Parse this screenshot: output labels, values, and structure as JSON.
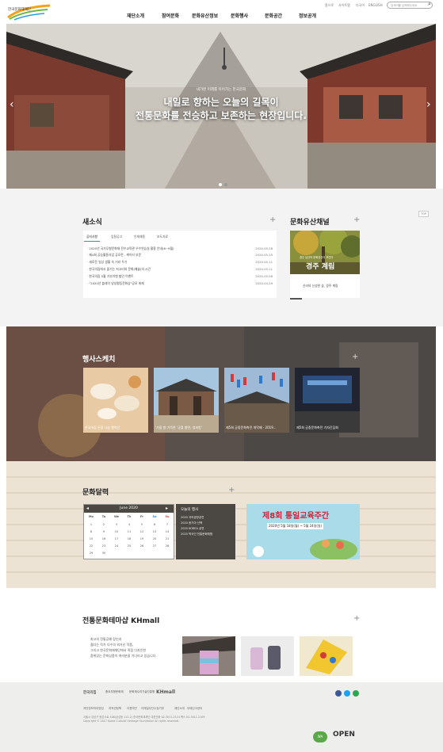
{
  "header": {
    "logo_text": "한국문화재재단",
    "util_links": [
      "홈으로",
      "사이트맵",
      "다국어",
      "ENGLISH"
    ],
    "search_placeholder": "검색어를 입력해주세요",
    "gnb": [
      "재단소개",
      "참여문화",
      "문화유산정보",
      "문화행사",
      "문화공간",
      "정보공개"
    ]
  },
  "hero": {
    "subtitle": "내가본 미래를 이어가는 한국문화",
    "title_line1": "내일로 향하는 오늘의 길목이",
    "title_line2": "전통문화를 전승하고 보존하는 현장입니다.",
    "prev": "‹",
    "next": "›"
  },
  "news": {
    "title": "새소식",
    "tabs": [
      "공지사항",
      "입찰공고",
      "인재채용",
      "보도자료"
    ],
    "items": [
      {
        "text": "2020년 국가무형문화재 전수교육관 우수연습실 활용 안내(6~9월)",
        "date": "2020.05.28"
      },
      {
        "text": "제4회 공능활용사업 공모전 - 케이티 부문",
        "date": "2020.05.25"
      },
      {
        "text": "세로운 일상 생활 속 거리 두기",
        "date": "2020.05.11"
      },
      {
        "text": "한국의집에서 즐기는 저고리와 문화(예술)의 시간",
        "date": "2020.05.11"
      },
      {
        "text": "한국의집 5월 기부이벤 할인 이벤트",
        "date": "2020.05.06"
      },
      {
        "text": "\"2020년 블레이 양성평등문화상\"공모 게재",
        "date": "2020.04.29"
      }
    ]
  },
  "channel": {
    "title": "문화유산채널",
    "img_small": "경주 남산의 문화유산이 보인다",
    "img_big": "경주 계림",
    "caption": "신라의 신성한 숲, 경주 계림",
    "side": "TOP"
  },
  "events": {
    "title": "행사스케치",
    "cards": [
      "한국의집 온정 나눔 행복단",
      "'가을 향 가득한 '궁궐 향연, 생과방'",
      "제5회 궁중문화축전 개막제 - 2019...",
      "제5회 궁중문화축전 기자간담회"
    ]
  },
  "calendar": {
    "title": "문화달력",
    "month": "June 2020",
    "weekdays": [
      "Mo",
      "Tu",
      "We",
      "Th",
      "Fr",
      "Sa",
      "Su"
    ],
    "weeks": [
      [
        "1",
        "2",
        "3",
        "4",
        "5",
        "6",
        "7"
      ],
      [
        "8",
        "9",
        "10",
        "11",
        "12",
        "13",
        "14"
      ],
      [
        "15",
        "16",
        "17",
        "18",
        "19",
        "20",
        "21"
      ],
      [
        "22",
        "23",
        "24",
        "25",
        "26",
        "27",
        "28"
      ],
      [
        "29",
        "30",
        "",
        "",
        "",
        "",
        ""
      ]
    ],
    "schedule_title": "오늘의 행사",
    "schedule": [
      "2020 국악공방공연",
      "2020 동기아 산책",
      "2020 KOREA 공연",
      "2020 박국인 전통문화체험"
    ],
    "banner_title": "제8회 통일교육주간",
    "banner_date": "2020년 5월 18일(월) ~ 5월 24일(일)"
  },
  "khmall": {
    "title": "전통문화테마샵 KHmall",
    "desc": [
      "최고의 전통공예 장인과",
      "젊다는 작가 다수의 워거난 작품,",
      "그리고 한국문화재재단에서 직접 디자인한",
      "품위있는 문화상품이 여러분을 기다리고 있습니다."
    ]
  },
  "footer": {
    "partners": [
      "한국의집",
      "중요무형문화재",
      "문화재수리기술진흥원",
      "KHmall"
    ],
    "links": [
      "개인정보처리방침",
      "저작권정책",
      "이용약관",
      "이메일무단수집거부",
      "재단소개",
      "부패신고센터"
    ],
    "address": "서울시 강남구 봉은사로 406(삼성동 112-2) 한국문화재재단 대표전화 02-3011-2114 팩스 02-3011-2109",
    "copyright": "Copyright © 2017 Korea Cultural Heritage Foundation All rights reserved.",
    "badges": [
      "WA",
      "OPEN"
    ]
  },
  "colors": {
    "accent": "#2a9d8f",
    "dark": "#4b4843",
    "footer": "#eeeeec",
    "sun": "#d23b3b"
  }
}
